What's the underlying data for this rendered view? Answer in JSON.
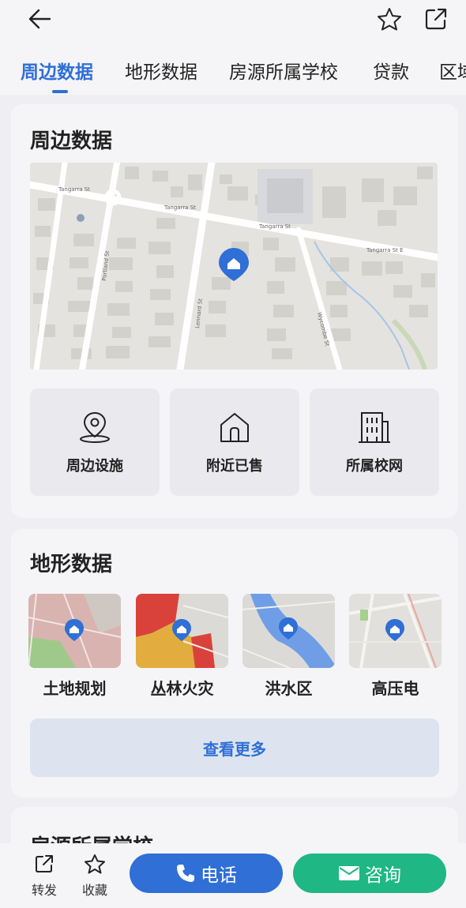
{
  "tabs": [
    {
      "label": "周边数据",
      "active": true
    },
    {
      "label": "地形数据"
    },
    {
      "label": "房源所属学校"
    },
    {
      "label": "贷款"
    },
    {
      "label": "区域"
    }
  ],
  "surrounding": {
    "title": "周边数据",
    "map": {
      "streets": [
        "Tangarra St",
        "Tangarra St E",
        "Portland St",
        "Lennard St",
        "Wycombe St"
      ],
      "marker_color": "#2f6fd6"
    },
    "facilities": [
      {
        "label": "周边设施",
        "icon": "location-pin-icon"
      },
      {
        "label": "附近已售",
        "icon": "house-icon"
      },
      {
        "label": "所属校网",
        "icon": "building-icon"
      }
    ]
  },
  "terrain": {
    "title": "地形数据",
    "items": [
      {
        "label": "土地规划"
      },
      {
        "label": "丛林火灾"
      },
      {
        "label": "洪水区"
      },
      {
        "label": "高压电"
      }
    ],
    "more_label": "查看更多"
  },
  "school_section": {
    "title": "房源所属学校"
  },
  "bottom_bar": {
    "share_label": "转发",
    "favorite_label": "收藏",
    "call_label": "电话",
    "consult_label": "咨询"
  },
  "colors": {
    "accent": "#2f6fd6",
    "green": "#1fb783"
  }
}
